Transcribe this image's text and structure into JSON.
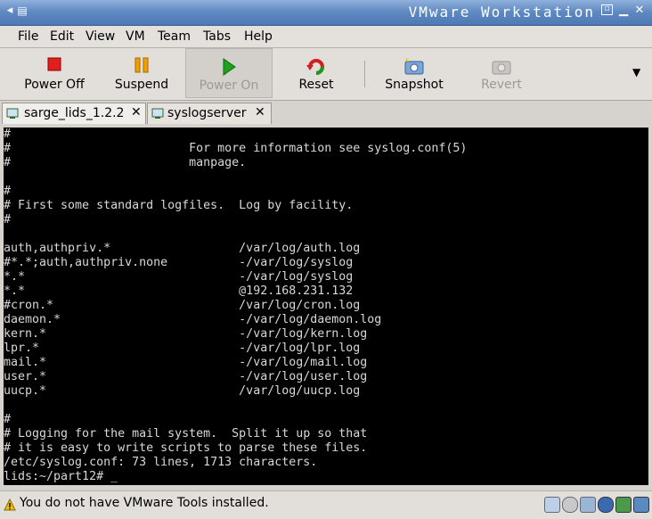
{
  "window": {
    "title": "VMware Workstation"
  },
  "menu": {
    "items": [
      "File",
      "Edit",
      "View",
      "VM",
      "Team",
      "Tabs",
      "Help"
    ]
  },
  "toolbar": {
    "power_off": "Power Off",
    "suspend": "Suspend",
    "power_on": "Power On",
    "reset": "Reset",
    "snapshot": "Snapshot",
    "revert": "Revert"
  },
  "tabs": [
    {
      "label": "sarge_lids_1.2.2"
    },
    {
      "label": "syslogserver"
    }
  ],
  "console": {
    "lines": [
      "#",
      "#                         For more information see syslog.conf(5)",
      "#                         manpage.",
      "",
      "#",
      "# First some standard logfiles.  Log by facility.",
      "#",
      "",
      "auth,authpriv.*                  /var/log/auth.log",
      "#*.*;auth,authpriv.none          -/var/log/syslog",
      "*.*                              -/var/log/syslog",
      "*.*                              @192.168.231.132",
      "#cron.*                          /var/log/cron.log",
      "daemon.*                         -/var/log/daemon.log",
      "kern.*                           -/var/log/kern.log",
      "lpr.*                            -/var/log/lpr.log",
      "mail.*                           -/var/log/mail.log",
      "user.*                           -/var/log/user.log",
      "uucp.*                           /var/log/uucp.log",
      "",
      "#",
      "# Logging for the mail system.  Split it up so that",
      "# it is easy to write scripts to parse these files.",
      "/etc/syslog.conf: 73 lines, 1713 characters.",
      "lids:~/part12# _"
    ]
  },
  "status": {
    "text": "You do not have VMware Tools installed."
  },
  "colors": {
    "title_bar": "#5e88c0",
    "console_bg": "#000000",
    "console_fg": "#d8d8d8",
    "power_off": "#e02020",
    "suspend": "#f0a000",
    "power_on": "#20a020"
  }
}
